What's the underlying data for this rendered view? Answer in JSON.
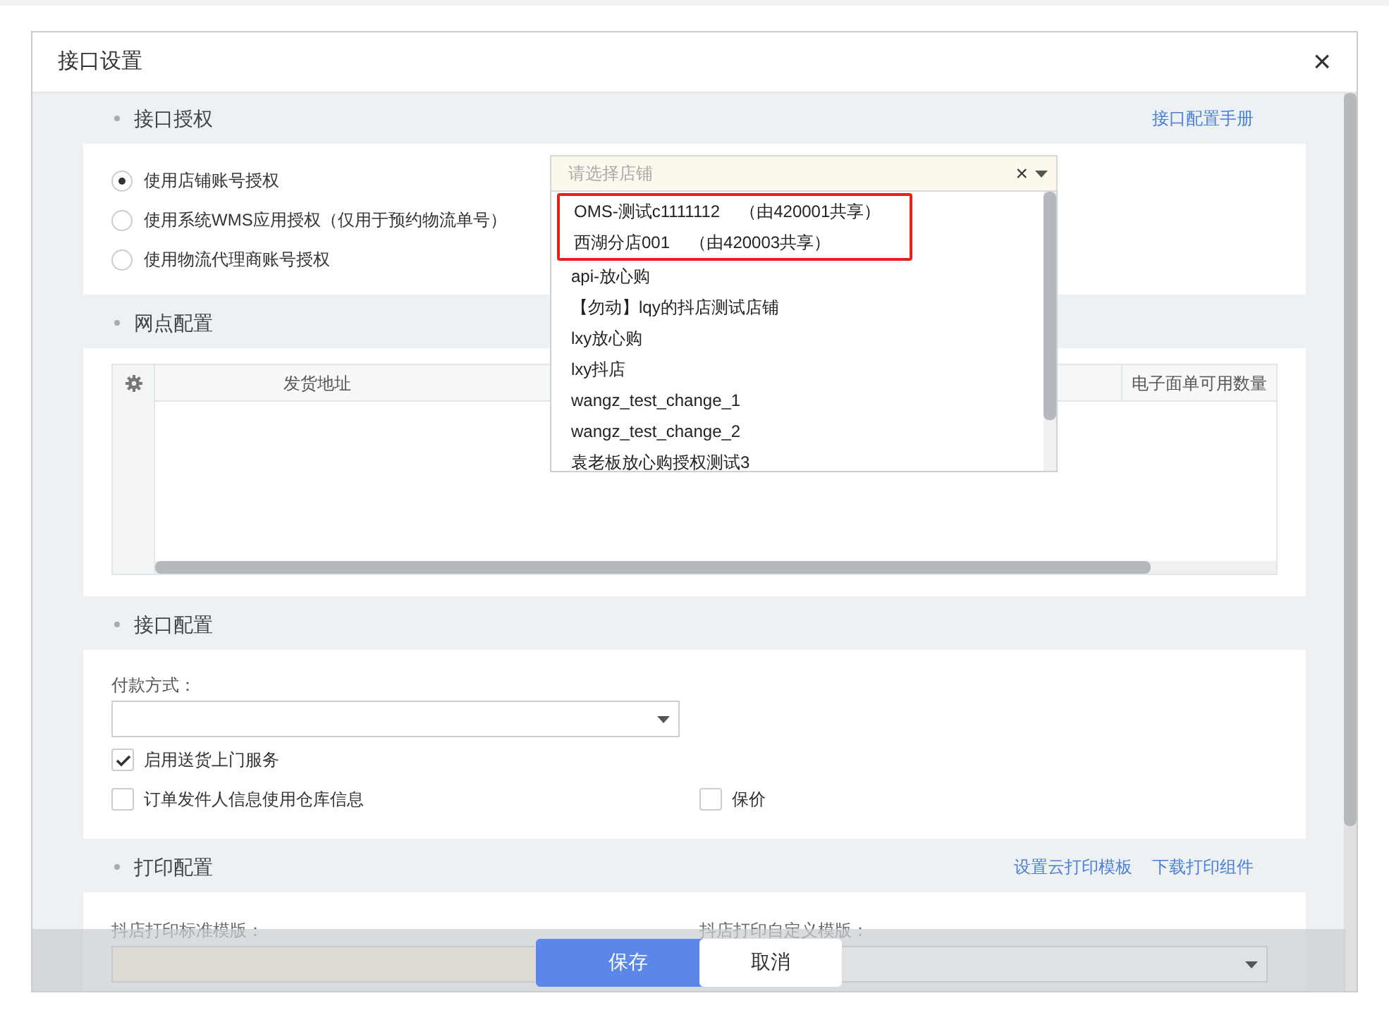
{
  "dialog": {
    "title": "接口设置",
    "close": "×"
  },
  "auth": {
    "heading": "接口授权",
    "manual_link": "接口配置手册",
    "options": [
      {
        "label": "使用店铺账号授权",
        "selected": true
      },
      {
        "label": "使用系统WMS应用授权（仅用于预约物流单号）",
        "selected": false
      },
      {
        "label": "使用物流代理商账号授权",
        "selected": false
      }
    ],
    "shop_select": {
      "placeholder": "请选择店铺",
      "clear": "×"
    },
    "shop_options": [
      {
        "name": "OMS-测试c1111112",
        "note": "（由420001共享）",
        "highlighted": true
      },
      {
        "name": "西湖分店001",
        "note": "（由420003共享）",
        "highlighted": true
      },
      {
        "name": "api-放心购",
        "highlighted": false
      },
      {
        "name": "【勿动】lqy的抖店测试店铺",
        "highlighted": false
      },
      {
        "name": "lxy放心购",
        "highlighted": false
      },
      {
        "name": "lxy抖店",
        "highlighted": false
      },
      {
        "name": "wangz_test_change_1",
        "highlighted": false
      },
      {
        "name": "wangz_test_change_2",
        "highlighted": false
      },
      {
        "name": "袁老板放心购授权测试3",
        "highlighted": false
      }
    ]
  },
  "outlets": {
    "heading": "网点配置",
    "columns": [
      "发货地址",
      "电子面单可用数量"
    ]
  },
  "interface": {
    "heading": "接口配置",
    "payment_label": "付款方式：",
    "checks": [
      {
        "label": "启用送货上门服务",
        "checked": true
      },
      {
        "label": "订单发件人信息使用仓库信息",
        "checked": false
      },
      {
        "label": "保价",
        "checked": false
      }
    ]
  },
  "print": {
    "heading": "打印配置",
    "links": [
      "设置云打印模板",
      "下载打印组件"
    ],
    "standard_label": "抖店打印标准模版：",
    "custom_label": "抖店打印自定义模版："
  },
  "footer": {
    "save": "保存",
    "cancel": "取消"
  }
}
